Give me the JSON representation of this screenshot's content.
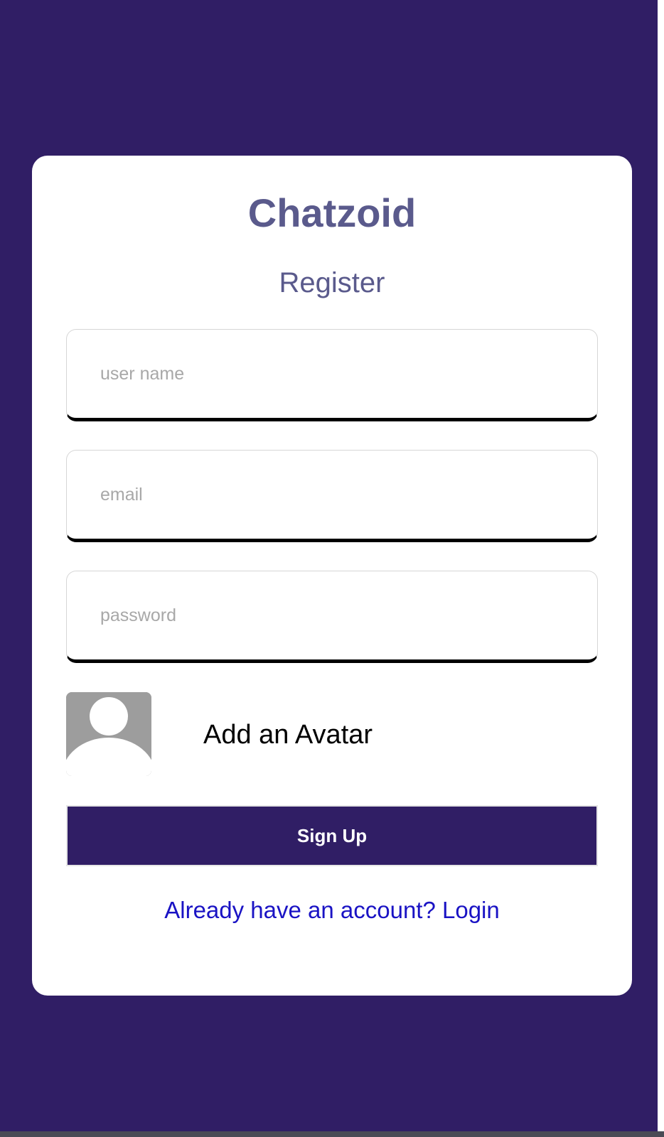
{
  "app": {
    "title": "Chatzoid",
    "subtitle": "Register"
  },
  "form": {
    "username": {
      "value": "",
      "placeholder": "user name"
    },
    "email": {
      "value": "",
      "placeholder": "email"
    },
    "password": {
      "value": "",
      "placeholder": "password"
    },
    "avatar_label": "Add an Avatar",
    "avatar_icon": "user-avatar-placeholder-icon",
    "submit_label": "Sign Up",
    "login_link": "Already have an account? Login"
  },
  "colors": {
    "background": "#301e65",
    "card": "#ffffff",
    "brand_text": "#5a5a8c",
    "button": "#301e65",
    "link": "#1a13c4",
    "avatar_placeholder": "#9d9d9d"
  }
}
